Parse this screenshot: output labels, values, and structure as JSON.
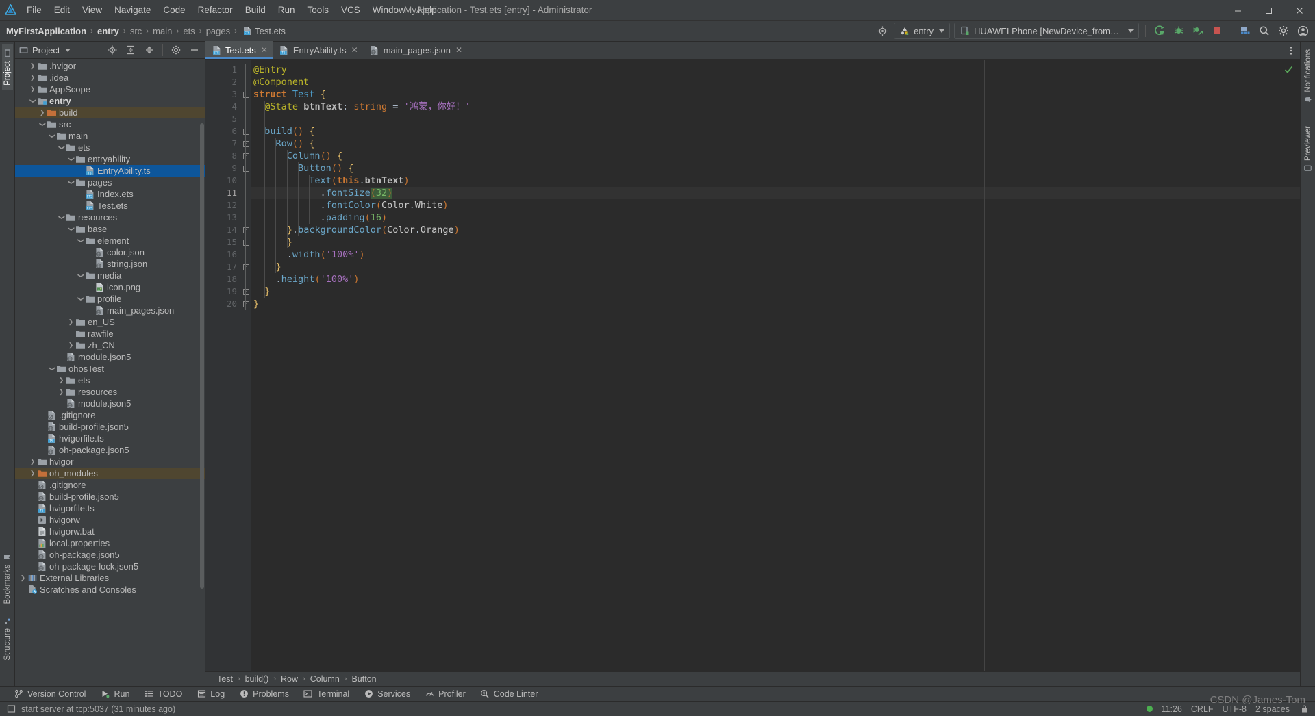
{
  "window": {
    "title": "MyApplication - Test.ets [entry] - Administrator",
    "logo_icon": "deveco-logo-icon",
    "minimize_icon": "minimize-icon",
    "maximize_icon": "maximize-icon",
    "close_icon": "close-icon"
  },
  "menu": [
    {
      "label": "File",
      "mnemonic": "F"
    },
    {
      "label": "Edit",
      "mnemonic": "E"
    },
    {
      "label": "View",
      "mnemonic": "V"
    },
    {
      "label": "Navigate",
      "mnemonic": "N"
    },
    {
      "label": "Code",
      "mnemonic": "C"
    },
    {
      "label": "Refactor",
      "mnemonic": "R"
    },
    {
      "label": "Build",
      "mnemonic": "B"
    },
    {
      "label": "Run",
      "mnemonic": "u"
    },
    {
      "label": "Tools",
      "mnemonic": "T"
    },
    {
      "label": "VCS",
      "mnemonic": "S"
    },
    {
      "label": "Window",
      "mnemonic": "W"
    },
    {
      "label": "Help",
      "mnemonic": "H"
    }
  ],
  "breadcrumb": {
    "items": [
      "MyFirstApplication",
      "entry",
      "src",
      "main",
      "ets",
      "pages",
      "Test.ets"
    ],
    "separator": "›",
    "file_icon": "ets-file-icon"
  },
  "toolbar": {
    "settings_icon": "target-settings-icon",
    "run_config": {
      "label": "entry",
      "icon": "module-icon"
    },
    "device": {
      "label": "HUAWEI Phone [NewDevice_from_Huawei_Phone]",
      "icon": "device-icon"
    },
    "actions": [
      {
        "name": "run-button",
        "icon": "run-icon",
        "color": "#59a869"
      },
      {
        "name": "debug-button",
        "icon": "debug-icon",
        "color": "#59a869"
      },
      {
        "name": "profile-button",
        "icon": "profile-icon",
        "color": "#59a869"
      },
      {
        "name": "stop-button",
        "icon": "stop-icon",
        "color": "#c75450"
      },
      {
        "name": "device-manager-button",
        "icon": "device-manager-icon",
        "color": "#6e9ed4"
      },
      {
        "name": "search-everywhere-button",
        "icon": "search-icon",
        "color": "#bbbbbb"
      },
      {
        "name": "settings-button",
        "icon": "gear-icon",
        "color": "#bbbbbb"
      },
      {
        "name": "account-button",
        "icon": "account-icon",
        "color": "#bbbbbb"
      }
    ]
  },
  "left_rail": {
    "top": [
      {
        "label": "Project",
        "icon": "project-icon",
        "active": true
      }
    ],
    "bottom": [
      {
        "label": "Bookmarks",
        "icon": "bookmark-icon",
        "active": false
      },
      {
        "label": "Structure",
        "icon": "structure-icon",
        "active": false
      }
    ]
  },
  "right_rail": {
    "items": [
      {
        "label": "Notifications",
        "icon": "notifications-icon"
      },
      {
        "label": "Previewer",
        "icon": "previewer-icon"
      }
    ]
  },
  "project_panel": {
    "title": "Project",
    "title_icon": "project-icon",
    "dropdown_icon": "chevron-down-icon",
    "actions": [
      {
        "name": "select-opened-file-button",
        "icon": "crosshair-icon"
      },
      {
        "name": "expand-all-button",
        "icon": "expand-all-icon"
      },
      {
        "name": "collapse-all-button",
        "icon": "collapse-all-icon"
      },
      {
        "name": "panel-settings-button",
        "icon": "gear-icon"
      },
      {
        "name": "hide-panel-button",
        "icon": "minus-icon"
      }
    ],
    "tree": [
      {
        "label": ".hvigor",
        "depth": 1,
        "icon": "folder",
        "arrow": "collapsed"
      },
      {
        "label": ".idea",
        "depth": 1,
        "icon": "folder",
        "arrow": "collapsed"
      },
      {
        "label": "AppScope",
        "depth": 1,
        "icon": "folder",
        "arrow": "collapsed"
      },
      {
        "label": "entry",
        "depth": 1,
        "icon": "module",
        "arrow": "expanded",
        "bold": true
      },
      {
        "label": "build",
        "depth": 2,
        "icon": "folder-orange",
        "arrow": "collapsed",
        "state": "hl"
      },
      {
        "label": "src",
        "depth": 2,
        "icon": "folder",
        "arrow": "expanded"
      },
      {
        "label": "main",
        "depth": 3,
        "icon": "folder",
        "arrow": "expanded"
      },
      {
        "label": "ets",
        "depth": 4,
        "icon": "folder",
        "arrow": "expanded"
      },
      {
        "label": "entryability",
        "depth": 5,
        "icon": "folder",
        "arrow": "expanded"
      },
      {
        "label": "EntryAbility.ts",
        "depth": 6,
        "icon": "ts-file",
        "arrow": "none",
        "state": "sel"
      },
      {
        "label": "pages",
        "depth": 5,
        "icon": "folder",
        "arrow": "expanded"
      },
      {
        "label": "Index.ets",
        "depth": 6,
        "icon": "ets-file",
        "arrow": "none"
      },
      {
        "label": "Test.ets",
        "depth": 6,
        "icon": "ets-file",
        "arrow": "none"
      },
      {
        "label": "resources",
        "depth": 4,
        "icon": "folder",
        "arrow": "expanded"
      },
      {
        "label": "base",
        "depth": 5,
        "icon": "folder",
        "arrow": "expanded"
      },
      {
        "label": "element",
        "depth": 6,
        "icon": "folder",
        "arrow": "expanded"
      },
      {
        "label": "color.json",
        "depth": 7,
        "icon": "json-file",
        "arrow": "none"
      },
      {
        "label": "string.json",
        "depth": 7,
        "icon": "json-file",
        "arrow": "none"
      },
      {
        "label": "media",
        "depth": 6,
        "icon": "folder",
        "arrow": "expanded"
      },
      {
        "label": "icon.png",
        "depth": 7,
        "icon": "png-file",
        "arrow": "none"
      },
      {
        "label": "profile",
        "depth": 6,
        "icon": "folder",
        "arrow": "expanded"
      },
      {
        "label": "main_pages.json",
        "depth": 7,
        "icon": "json-file",
        "arrow": "none"
      },
      {
        "label": "en_US",
        "depth": 5,
        "icon": "folder",
        "arrow": "collapsed"
      },
      {
        "label": "rawfile",
        "depth": 5,
        "icon": "folder",
        "arrow": "none"
      },
      {
        "label": "zh_CN",
        "depth": 5,
        "icon": "folder",
        "arrow": "collapsed"
      },
      {
        "label": "module.json5",
        "depth": 4,
        "icon": "json-file",
        "arrow": "none"
      },
      {
        "label": "ohosTest",
        "depth": 3,
        "icon": "folder",
        "arrow": "expanded"
      },
      {
        "label": "ets",
        "depth": 4,
        "icon": "folder",
        "arrow": "collapsed"
      },
      {
        "label": "resources",
        "depth": 4,
        "icon": "folder",
        "arrow": "collapsed"
      },
      {
        "label": "module.json5",
        "depth": 4,
        "icon": "json-file",
        "arrow": "none"
      },
      {
        "label": ".gitignore",
        "depth": 2,
        "icon": "gitignore-file",
        "arrow": "none"
      },
      {
        "label": "build-profile.json5",
        "depth": 2,
        "icon": "json-file",
        "arrow": "none"
      },
      {
        "label": "hvigorfile.ts",
        "depth": 2,
        "icon": "ts-file",
        "arrow": "none"
      },
      {
        "label": "oh-package.json5",
        "depth": 2,
        "icon": "json-file",
        "arrow": "none"
      },
      {
        "label": "hvigor",
        "depth": 1,
        "icon": "folder",
        "arrow": "collapsed"
      },
      {
        "label": "oh_modules",
        "depth": 1,
        "icon": "folder-orange",
        "arrow": "collapsed",
        "state": "hl"
      },
      {
        "label": ".gitignore",
        "depth": 1,
        "icon": "gitignore-file",
        "arrow": "none"
      },
      {
        "label": "build-profile.json5",
        "depth": 1,
        "icon": "json-file",
        "arrow": "none"
      },
      {
        "label": "hvigorfile.ts",
        "depth": 1,
        "icon": "ts-file",
        "arrow": "none"
      },
      {
        "label": "hvigorw",
        "depth": 1,
        "icon": "script-file",
        "arrow": "none"
      },
      {
        "label": "hvigorw.bat",
        "depth": 1,
        "icon": "bat-file",
        "arrow": "none"
      },
      {
        "label": "local.properties",
        "depth": 1,
        "icon": "properties-file",
        "arrow": "none"
      },
      {
        "label": "oh-package.json5",
        "depth": 1,
        "icon": "json-file",
        "arrow": "none"
      },
      {
        "label": "oh-package-lock.json5",
        "depth": 1,
        "icon": "json-file",
        "arrow": "none"
      },
      {
        "label": "External Libraries",
        "depth": 0,
        "icon": "libraries-icon",
        "arrow": "collapsed"
      },
      {
        "label": "Scratches and Consoles",
        "depth": 0,
        "icon": "scratches-icon",
        "arrow": "none"
      }
    ]
  },
  "editor": {
    "tabs": [
      {
        "label": "Test.ets",
        "icon": "ets-file-icon",
        "active": true,
        "close_icon": "close-icon"
      },
      {
        "label": "EntryAbility.ts",
        "icon": "ts-file-icon",
        "active": false,
        "close_icon": "close-icon"
      },
      {
        "label": "main_pages.json",
        "icon": "json-file-icon",
        "active": false,
        "close_icon": "close-icon"
      }
    ],
    "tabs_more_icon": "more-options-icon",
    "inspection_status_icon": "check-mark-icon",
    "current_line": 11,
    "line_numbers": [
      1,
      2,
      3,
      4,
      5,
      6,
      7,
      8,
      9,
      10,
      11,
      12,
      13,
      14,
      15,
      16,
      17,
      18,
      19,
      20
    ],
    "code_lines": [
      "@Entry",
      "@Component",
      "struct Test {",
      "  @State btnText: string = '鸿蒙，你好！'",
      "",
      "  build() {",
      "    Row() {",
      "      Column() {",
      "        Button() {",
      "          Text(this.btnText)",
      "            .fontSize(32)",
      "            .fontColor(Color.White)",
      "            .padding(16)",
      "      }.backgroundColor(Color.Orange)",
      "      }",
      "      .width('100%')",
      "    }",
      "    .height('100%')",
      "  }",
      "}"
    ],
    "breadcrumbs": [
      "Test",
      "build()",
      "Row",
      "Column",
      "Button"
    ],
    "breadcrumb_separator": "›"
  },
  "toolwindows": [
    {
      "label": "Version Control",
      "icon": "vcs-icon"
    },
    {
      "label": "Run",
      "icon": "run-icon"
    },
    {
      "label": "TODO",
      "icon": "todo-icon"
    },
    {
      "label": "Log",
      "icon": "log-icon"
    },
    {
      "label": "Problems",
      "icon": "problems-icon"
    },
    {
      "label": "Terminal",
      "icon": "terminal-icon"
    },
    {
      "label": "Services",
      "icon": "services-icon"
    },
    {
      "label": "Profiler",
      "icon": "profiler-icon"
    },
    {
      "label": "Code Linter",
      "icon": "code-linter-icon"
    }
  ],
  "statusbar": {
    "message": "start server at tcp:5037 (31 minutes ago)",
    "message_icon": "event-log-icon",
    "time": "11:26",
    "line_separator": "CRLF",
    "encoding": "UTF-8",
    "indent": "2 spaces",
    "lock_icon": "lock-icon",
    "watermark": "CSDN @James-Tom"
  },
  "colors": {
    "accent": "#4a88c7",
    "selection": "#0d569b",
    "highlight": "#4f4630",
    "run_green": "#59a869",
    "stop_red": "#c75450",
    "panel_bg": "#3c3f41",
    "editor_bg": "#2b2b2b",
    "gutter_bg": "#313335"
  }
}
